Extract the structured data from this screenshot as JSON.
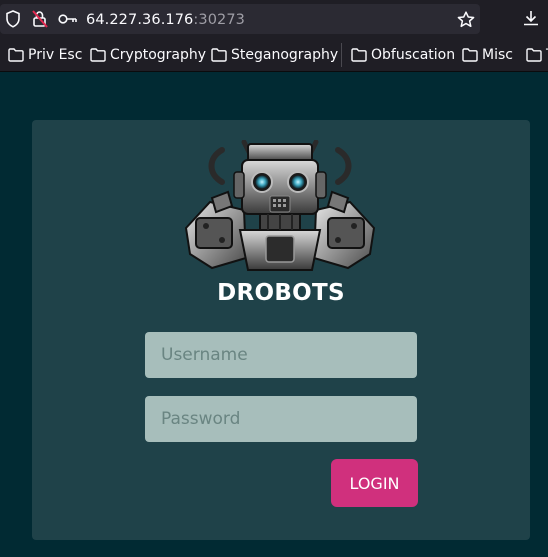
{
  "browser": {
    "url_host": "64.227.36.176",
    "url_port": ":30273",
    "icons": [
      "shield-icon",
      "lock-warning-icon",
      "key-icon",
      "star-icon",
      "download-icon"
    ],
    "bookmarks": [
      {
        "label": "Priv Esc",
        "icon": "folder-icon"
      },
      {
        "label": "Cryptography",
        "icon": "folder-icon"
      },
      {
        "label": "Steganography",
        "icon": "folder-icon"
      },
      {
        "label": "Obfuscation",
        "icon": "folder-icon"
      },
      {
        "label": "Misc",
        "icon": "folder-icon"
      },
      {
        "label": "T",
        "icon": "folder-icon"
      }
    ]
  },
  "login": {
    "brand": "DROBOTS",
    "logo": "robot-logo",
    "username_placeholder": "Username",
    "password_placeholder": "Password",
    "submit_label": "LOGIN"
  },
  "colors": {
    "page_background": "#012a33",
    "card_background": "#1f4249",
    "input_background": "#a7bebb",
    "button_background": "#d0307d",
    "chrome_background": "#1f1e25"
  }
}
